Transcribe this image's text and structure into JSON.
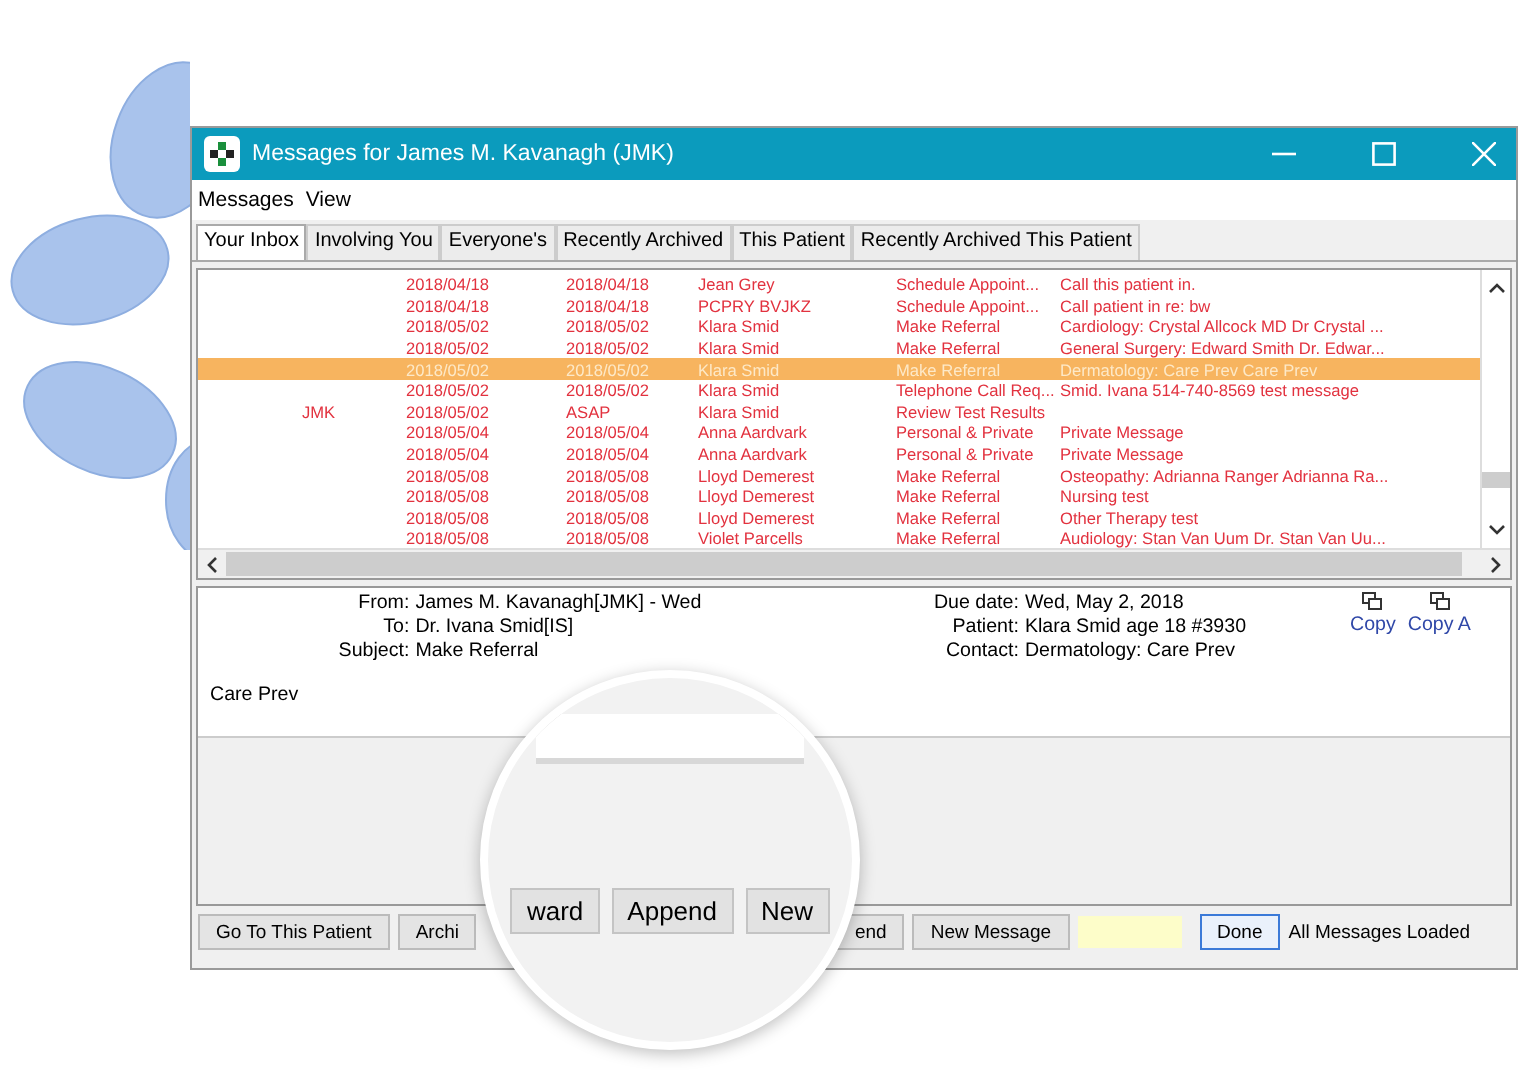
{
  "window": {
    "title": "Messages for James M. Kavanagh (JMK)"
  },
  "menu": [
    "Messages",
    "View"
  ],
  "tabs": [
    {
      "label": "Your Inbox",
      "selected": true
    },
    {
      "label": "Involving You",
      "selected": false
    },
    {
      "label": "Everyone's",
      "selected": false
    },
    {
      "label": "Recently Archived",
      "selected": false
    },
    {
      "label": "This Patient",
      "selected": false
    },
    {
      "label": "Recently Archived This Patient",
      "selected": false
    }
  ],
  "table": {
    "rows": [
      {
        "selected": false,
        "cells": [
          "",
          "2018/04/18",
          "2018/04/18",
          "Jean Grey",
          "Schedule Appoint...",
          "Call this patient in."
        ]
      },
      {
        "selected": false,
        "cells": [
          "",
          "2018/04/18",
          "2018/04/18",
          "PCPRY BVJKZ",
          "Schedule Appoint...",
          "Call patient in re: bw"
        ]
      },
      {
        "selected": false,
        "cells": [
          "",
          "2018/05/02",
          "2018/05/02",
          "Klara Smid",
          "Make Referral",
          "Cardiology: Crystal Allcock MD  Dr Crystal ..."
        ]
      },
      {
        "selected": false,
        "cells": [
          "",
          "2018/05/02",
          "2018/05/02",
          "Klara Smid",
          "Make Referral",
          "General Surgery: Edward Smith  Dr. Edwar..."
        ]
      },
      {
        "selected": true,
        "cells": [
          "",
          "2018/05/02",
          "2018/05/02",
          "Klara Smid",
          "Make Referral",
          "Dermatology: Care Prev  Care Prev"
        ]
      },
      {
        "selected": false,
        "cells": [
          "",
          "2018/05/02",
          "2018/05/02",
          "Klara Smid",
          "Telephone Call Req...",
          "Smid. Ivana 514-740-8569 test message"
        ]
      },
      {
        "selected": false,
        "cells": [
          "JMK",
          "2018/05/02",
          "ASAP",
          "Klara Smid",
          "Review Test Results",
          ""
        ]
      },
      {
        "selected": false,
        "cells": [
          "",
          "2018/05/04",
          "2018/05/04",
          "Anna Aardvark",
          "Personal & Private",
          "Private Message"
        ]
      },
      {
        "selected": false,
        "cells": [
          "",
          "2018/05/04",
          "2018/05/04",
          "Anna Aardvark",
          "Personal & Private",
          "Private Message"
        ]
      },
      {
        "selected": false,
        "cells": [
          "",
          "2018/05/08",
          "2018/05/08",
          "Lloyd Demerest",
          "Make Referral",
          "Osteopathy: Adrianna Ranger  Adrianna Ra..."
        ]
      },
      {
        "selected": false,
        "cells": [
          "",
          "2018/05/08",
          "2018/05/08",
          "Lloyd Demerest",
          "Make Referral",
          "Nursing  test"
        ]
      },
      {
        "selected": false,
        "cells": [
          "",
          "2018/05/08",
          "2018/05/08",
          "Lloyd Demerest",
          "Make Referral",
          "Other Therapy  test"
        ]
      },
      {
        "selected": false,
        "cells": [
          "",
          "2018/05/08",
          "2018/05/08",
          "Violet Parcells",
          "Make Referral",
          "Audiology: Stan Van Uum  Dr. Stan Van Uu..."
        ]
      }
    ]
  },
  "message": {
    "left": [
      {
        "label": "From:",
        "value": "James M. Kavanagh[JMK] - Wed"
      },
      {
        "label": "To:",
        "value": "Dr. Ivana Smid[IS]"
      },
      {
        "label": "Subject:",
        "value": "Make Referral"
      }
    ],
    "right": [
      {
        "label": "Due date:",
        "value": "Wed, May 2, 2018"
      },
      {
        "label": "Patient:",
        "value": "Klara Smid   age 18   #3930"
      },
      {
        "label": "Contact:",
        "value": "Dermatology: Care Prev"
      }
    ],
    "copy_links": [
      "Copy",
      "Copy A"
    ],
    "body": "Care Prev"
  },
  "magnifier": {
    "buttons": [
      "ward",
      "Append",
      "New"
    ]
  },
  "bottom_bar": {
    "left_buttons": [
      "Go To This Patient",
      "Archi"
    ],
    "right_buttons": [
      "end",
      "New Message"
    ],
    "done": "Done",
    "status": "All Messages Loaded"
  }
}
